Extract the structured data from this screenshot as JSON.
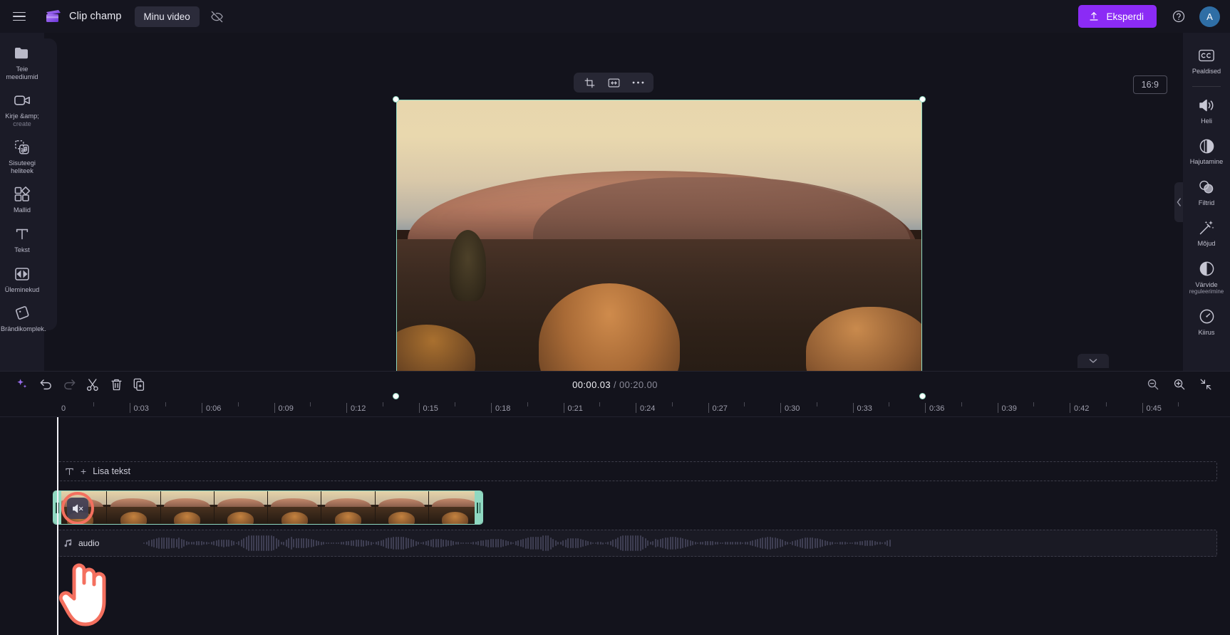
{
  "app": {
    "brand_name": "Clip champ",
    "project_name": "Minu video",
    "export_label": "Eksperdi",
    "avatar_initial": "A",
    "accent_color": "#8b2bf5",
    "selection_color": "#8fd8c1",
    "highlight_color": "#f4705f"
  },
  "topbar": {
    "menu_icon": "hamburger-icon",
    "logo_icon": "clipchamp-logo-icon",
    "hide_icon": "eye-off-icon",
    "export_icon": "upload-icon",
    "help_icon": "question-circle-icon"
  },
  "sidebar": {
    "items": [
      {
        "label": "Teie meediumid",
        "sub": "",
        "icon": "folder-icon"
      },
      {
        "label": "Kirje &amp;",
        "sub": "create",
        "icon": "video-camera-icon"
      },
      {
        "label": "Sisuteegi",
        "sub": "heliteek",
        "icon": "music-library-icon"
      },
      {
        "label": "Mallid",
        "sub": "",
        "icon": "templates-icon"
      },
      {
        "label": "Tekst",
        "sub": "",
        "icon": "text-icon"
      },
      {
        "label": "Üleminekud",
        "sub": "",
        "icon": "transitions-icon"
      },
      {
        "label": "Brändikomplekt",
        "sub": "",
        "icon": "brand-kit-icon"
      }
    ]
  },
  "right_sidebar": {
    "items": [
      {
        "label": "Pealdised",
        "sub": "",
        "icon": "closed-caption-icon",
        "divider_after": true
      },
      {
        "label": "Heli",
        "sub": "",
        "icon": "speaker-icon",
        "divider_after": false
      },
      {
        "label": "Hajutamine",
        "sub": "",
        "icon": "fade-icon",
        "divider_after": false
      },
      {
        "label": "Filtrid",
        "sub": "",
        "icon": "filters-icon",
        "divider_after": false
      },
      {
        "label": "Mõjud",
        "sub": "",
        "icon": "effects-wand-icon",
        "divider_after": false
      },
      {
        "label": "Värvide",
        "sub": "reguleerimine",
        "icon": "color-adjust-icon",
        "divider_after": false
      },
      {
        "label": "Kiirus",
        "sub": "",
        "icon": "speed-gauge-icon",
        "divider_after": false
      }
    ],
    "collapse_icon": "chevron-left-icon"
  },
  "canvas": {
    "aspect_ratio": "16:9",
    "float_toolbar": [
      {
        "icon": "crop-icon",
        "name": "crop-button"
      },
      {
        "icon": "fit-resize-icon",
        "name": "fit-button"
      },
      {
        "icon": "more-horizontal-icon",
        "name": "more-options-button"
      }
    ],
    "rotate_icon": "rotate-icon",
    "ai_icon": "ai-image-icon",
    "fullscreen_icon": "fullscreen-icon",
    "controls": [
      {
        "icon": "skip-to-start-icon",
        "name": "skip-to-start-button"
      },
      {
        "icon": "rewind-5-icon",
        "name": "rewind-5-button"
      },
      {
        "icon": "play-icon",
        "name": "play-button"
      },
      {
        "icon": "forward-5-icon",
        "name": "forward-5-button"
      },
      {
        "icon": "skip-to-end-icon",
        "name": "skip-to-end-button"
      }
    ]
  },
  "timeline": {
    "current_time": "00:00.03",
    "separator": "/",
    "total_time": "00:20.00",
    "tools": [
      {
        "icon": "sparkle-ai-icon",
        "name": "ai-tools-button",
        "dim": false
      },
      {
        "icon": "undo-icon",
        "name": "undo-button",
        "dim": false
      },
      {
        "icon": "redo-icon",
        "name": "redo-button",
        "dim": true
      },
      {
        "icon": "scissors-icon",
        "name": "split-button",
        "dim": false
      },
      {
        "icon": "trash-icon",
        "name": "delete-button",
        "dim": false
      },
      {
        "icon": "duplicate-icon",
        "name": "duplicate-button",
        "dim": false
      }
    ],
    "right_tools": [
      {
        "icon": "zoom-out-icon",
        "name": "zoom-out-button"
      },
      {
        "icon": "zoom-in-icon",
        "name": "zoom-in-button"
      },
      {
        "icon": "fit-timeline-icon",
        "name": "fit-timeline-button"
      }
    ],
    "collapse_icon": "chevron-down-icon",
    "ruler_labels": [
      "0",
      "0:03",
      "0:06",
      "0:09",
      "0:12",
      "0:15",
      "0:18",
      "0:21",
      "0:24",
      "0:27",
      "0:30",
      "0:33",
      "0:36",
      "0:39",
      "0:42",
      "0:45"
    ],
    "text_track": {
      "icon": "text-T-icon",
      "plus": "+",
      "label": "Lisa tekst"
    },
    "video_clip": {
      "mute_icon": "speaker-mute-icon",
      "handle_icon": "resize-handle-icon"
    },
    "audio_clip": {
      "icon": "music-note-icon",
      "label": "audio"
    }
  }
}
